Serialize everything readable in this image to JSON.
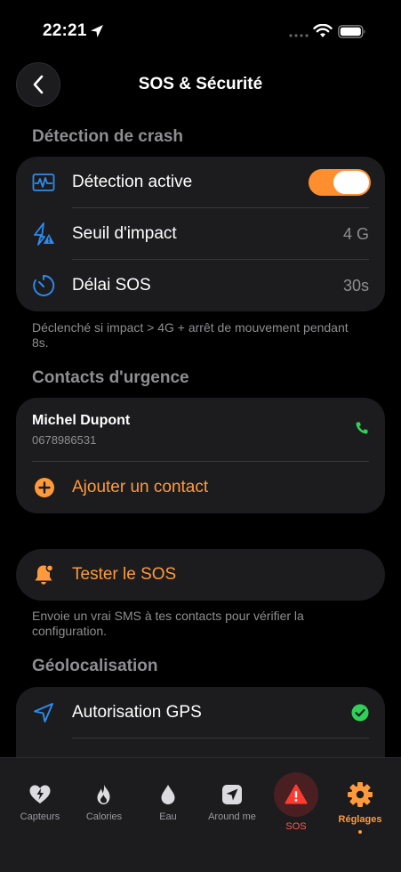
{
  "status_bar": {
    "time": "22:21"
  },
  "header": {
    "title": "SOS & Sécurité"
  },
  "crash_section": {
    "title": "Détection de crash",
    "rows": [
      {
        "label": "Détection active",
        "icon": "waveform-icon",
        "toggle_on": true
      },
      {
        "label": "Seuil d'impact",
        "icon": "impact-bolt-icon",
        "value": "4 G"
      },
      {
        "label": "Délai SOS",
        "icon": "timer-icon",
        "value": "30s"
      }
    ],
    "footnote": "Déclenché si impact > 4G + arrêt de mouvement pendant 8s."
  },
  "contacts_section": {
    "title": "Contacts d'urgence",
    "contacts": [
      {
        "name": "Michel Dupont",
        "phone": "0678986531"
      }
    ],
    "add_label": "Ajouter un contact"
  },
  "test_sos": {
    "label": "Tester le SOS",
    "footnote": "Envoie un vrai SMS à tes contacts pour vérifier la configuration."
  },
  "geo_section": {
    "title": "Géolocalisation",
    "rows": [
      {
        "label": "Autorisation GPS",
        "icon": "location-arrow-icon",
        "status": "granted"
      }
    ]
  },
  "tab_bar": {
    "tabs": [
      {
        "label": "Capteurs",
        "icon": "heart-bolt-icon"
      },
      {
        "label": "Calories",
        "icon": "flame-icon"
      },
      {
        "label": "Eau",
        "icon": "drop-icon"
      },
      {
        "label": "Around me",
        "icon": "navigation-icon"
      },
      {
        "label": "SOS",
        "icon": "warning-icon"
      },
      {
        "label": "Réglages",
        "icon": "gear-icon",
        "selected": true
      }
    ]
  },
  "colors": {
    "accent": "#ff9a3c",
    "card": "#1c1c1e",
    "secondary_text": "#8e8e93",
    "icon_blue": "#2d8cf0",
    "success": "#30d158",
    "danger": "#ff3b30"
  }
}
